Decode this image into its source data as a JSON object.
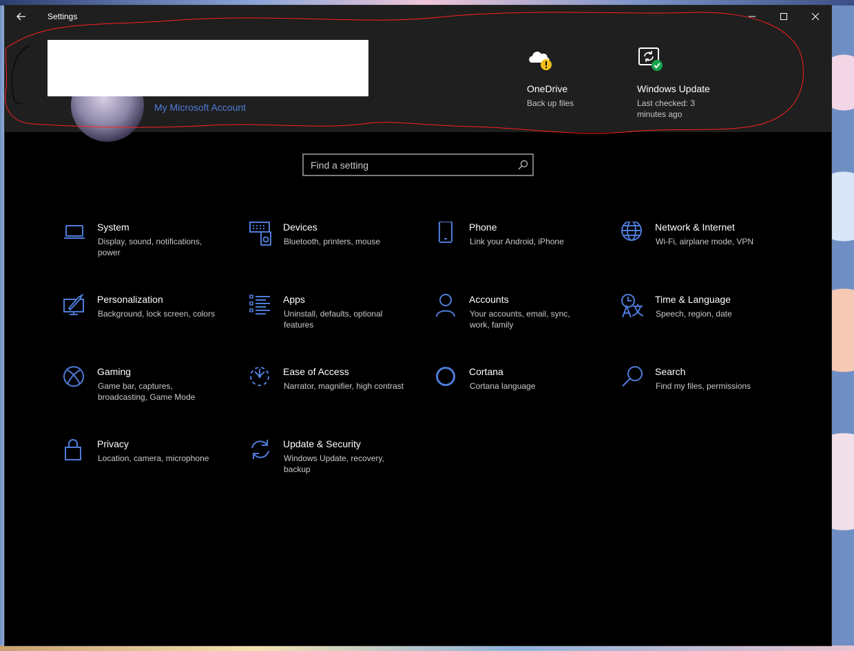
{
  "window": {
    "title": "Settings"
  },
  "header": {
    "account_link": "My Microsoft Account",
    "onedrive": {
      "title": "OneDrive",
      "subtitle": "Back up files",
      "icon": "cloud-warning-icon"
    },
    "windows_update": {
      "title": "Windows Update",
      "subtitle": "Last checked: 3 minutes ago",
      "icon": "update-check-icon"
    }
  },
  "search": {
    "placeholder": "Find a setting"
  },
  "categories": [
    {
      "name": "System",
      "desc": "Display, sound, notifications, power",
      "icon": "laptop-icon"
    },
    {
      "name": "Devices",
      "desc": "Bluetooth, printers, mouse",
      "icon": "devices-icon"
    },
    {
      "name": "Phone",
      "desc": "Link your Android, iPhone",
      "icon": "phone-icon"
    },
    {
      "name": "Network & Internet",
      "desc": "Wi-Fi, airplane mode, VPN",
      "icon": "globe-icon"
    },
    {
      "name": "Personalization",
      "desc": "Background, lock screen, colors",
      "icon": "paint-icon"
    },
    {
      "name": "Apps",
      "desc": "Uninstall, defaults, optional features",
      "icon": "apps-list-icon"
    },
    {
      "name": "Accounts",
      "desc": "Your accounts, email, sync, work, family",
      "icon": "person-icon"
    },
    {
      "name": "Time & Language",
      "desc": "Speech, region, date",
      "icon": "time-language-icon"
    },
    {
      "name": "Gaming",
      "desc": "Game bar, captures, broadcasting, Game Mode",
      "icon": "xbox-icon"
    },
    {
      "name": "Ease of Access",
      "desc": "Narrator, magnifier, high contrast",
      "icon": "ease-of-access-icon"
    },
    {
      "name": "Cortana",
      "desc": "Cortana language",
      "icon": "cortana-icon"
    },
    {
      "name": "Search",
      "desc": "Find my files, permissions",
      "icon": "search-icon"
    },
    {
      "name": "Privacy",
      "desc": "Location, camera, microphone",
      "icon": "lock-icon"
    },
    {
      "name": "Update & Security",
      "desc": "Windows Update, recovery, backup",
      "icon": "sync-icon"
    }
  ],
  "colors": {
    "accent": "#4f7cd9",
    "background": "#000000",
    "header": "#1f1f1f",
    "annotation": "#ff2020",
    "warning": "#f2c21a",
    "success": "#16a34a"
  }
}
